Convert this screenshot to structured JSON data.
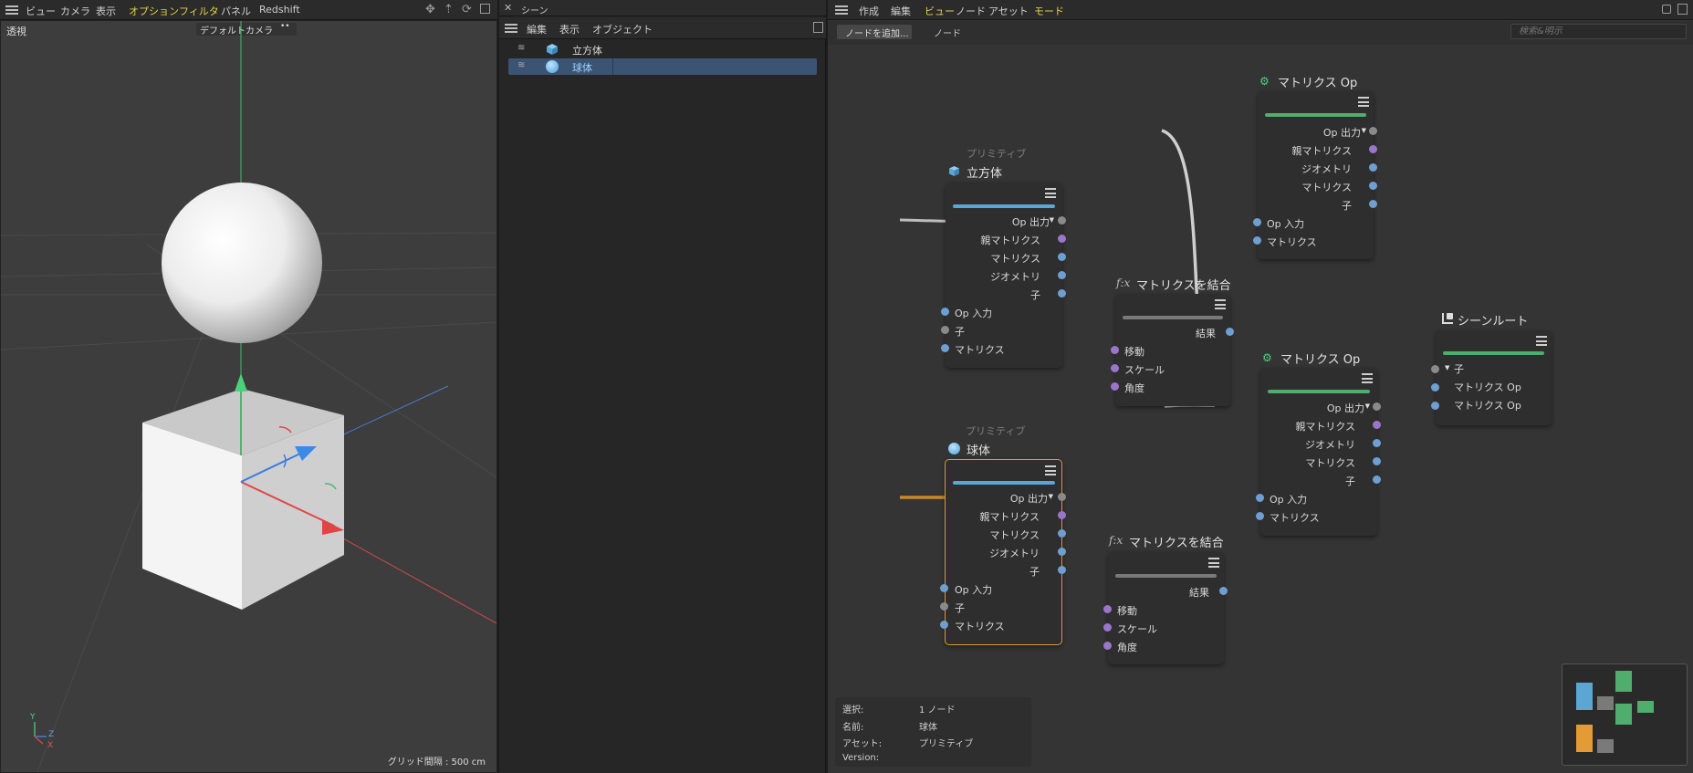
{
  "viewport": {
    "menu": [
      "ビュー",
      "カメラ",
      "表示",
      "オプション",
      "フィルタ",
      "パネル",
      "Redshift"
    ],
    "menu_highlight": [
      "オプション",
      "フィルタ"
    ],
    "view_name": "透視",
    "camera": "デフォルトカメラ",
    "camera_icon": "••",
    "grid_spacing": "グリッド間隔 : 500 cm",
    "axis": {
      "y": "Y",
      "z": "Z",
      "x": "X"
    }
  },
  "outliner": {
    "close_glyph": "✕",
    "title": "シーン",
    "menu": [
      "編集",
      "表示",
      "オブジェクト"
    ],
    "items": [
      {
        "label": "立方体",
        "icon": "cube-icon",
        "selected": false
      },
      {
        "label": "球体",
        "icon": "sphere-icon",
        "selected": true
      }
    ]
  },
  "node_editor": {
    "menu": [
      "作成",
      "編集",
      "ビュー",
      "ノード",
      "アセット",
      "モード"
    ],
    "menu_highlight": [
      "ビュー",
      "モード"
    ],
    "add_node_button": "ノードを追加...",
    "node_tab": "ノード",
    "search_placeholder": "検索&明示",
    "nodes": {
      "cube": {
        "subtitle": "プリミティブ",
        "title": "立方体",
        "outputs": [
          "Op 出力",
          "親マトリクス",
          "マトリクス",
          "ジオメトリ",
          "子"
        ],
        "inputs": [
          "Op 入力",
          "子",
          "マトリクス"
        ]
      },
      "sphere": {
        "subtitle": "プリミティブ",
        "title": "球体",
        "outputs": [
          "Op 出力",
          "親マトリクス",
          "マトリクス",
          "ジオメトリ",
          "子"
        ],
        "inputs": [
          "Op 入力",
          "子",
          "マトリクス"
        ]
      },
      "matop1": {
        "title": "マトリクス Op",
        "outputs": [
          "Op 出力",
          "親マトリクス",
          "ジオメトリ",
          "マトリクス",
          "子"
        ],
        "inputs": [
          "Op 入力",
          "マトリクス"
        ]
      },
      "matop2": {
        "title": "マトリクス Op",
        "outputs": [
          "Op 出力",
          "親マトリクス",
          "ジオメトリ",
          "マトリクス",
          "子"
        ],
        "inputs": [
          "Op 入力",
          "マトリクス"
        ]
      },
      "combine1": {
        "fx": "f:x",
        "title": "マトリクスを結合",
        "output": "結果",
        "inputs": [
          "移動",
          "スケール",
          "角度"
        ]
      },
      "combine2": {
        "fx": "f:x",
        "title": "マトリクスを結合",
        "output": "結果",
        "inputs": [
          "移動",
          "スケール",
          "角度"
        ]
      },
      "root": {
        "title": "シーンルート",
        "inputs": [
          "子",
          "マトリクス Op",
          "マトリクス Op"
        ]
      }
    },
    "info": [
      {
        "label": "選択:",
        "value": "1 ノード"
      },
      {
        "label": "名前:",
        "value": "球体"
      },
      {
        "label": "アセット:",
        "value": "プリミティブ"
      },
      {
        "label": "Version:",
        "value": ""
      }
    ],
    "colors": {
      "primitive": "#5aa7d6",
      "matrix_op": "#4fae6e",
      "combine": "#7a7a7a",
      "root": "#4fae6e",
      "selected_wire": "#c88a23"
    }
  }
}
